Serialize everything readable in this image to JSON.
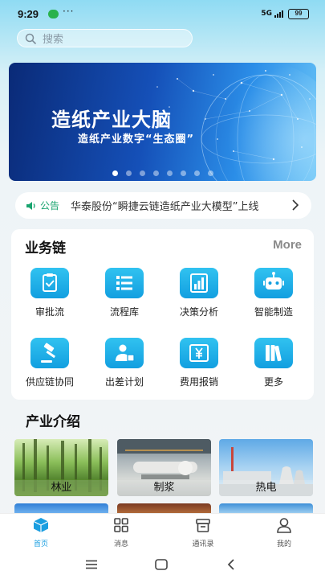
{
  "status_bar": {
    "time": "9:29",
    "dots": "···",
    "network": "5G",
    "battery": "99"
  },
  "search": {
    "placeholder": "搜索"
  },
  "banner": {
    "title": "造纸产业大脑",
    "subtitle": "造纸产业数字“生态圈”",
    "slide_count": 8,
    "active_slide": 0
  },
  "notice": {
    "label": "公告",
    "text": "华泰股份“瞬捷云链造纸产业大模型”上线"
  },
  "business": {
    "heading": "业务链",
    "more": "More",
    "items": [
      {
        "label": "审批流",
        "icon": "approval-clipboard-icon"
      },
      {
        "label": "流程库",
        "icon": "process-list-icon"
      },
      {
        "label": "决策分析",
        "icon": "bar-chart-icon"
      },
      {
        "label": "智能制造",
        "icon": "robot-icon"
      },
      {
        "label": "供应链协同",
        "icon": "gavel-icon"
      },
      {
        "label": "出差计划",
        "icon": "travel-person-icon"
      },
      {
        "label": "费用报销",
        "icon": "yuan-receipt-icon"
      },
      {
        "label": "更多",
        "icon": "books-icon"
      }
    ]
  },
  "industry": {
    "heading": "产业介绍",
    "tiles": [
      {
        "label": "林业"
      },
      {
        "label": "制浆"
      },
      {
        "label": "热电"
      }
    ]
  },
  "tabbar": {
    "tabs": [
      {
        "label": "首页",
        "icon": "home-cube-icon",
        "active": true
      },
      {
        "label": "消息",
        "icon": "grid-icon",
        "active": false
      },
      {
        "label": "通讯录",
        "icon": "contacts-box-icon",
        "active": false
      },
      {
        "label": "我的",
        "icon": "person-icon",
        "active": false
      }
    ]
  },
  "colors": {
    "accent": "#1a9ee0",
    "notice_green": "#19a46f"
  }
}
